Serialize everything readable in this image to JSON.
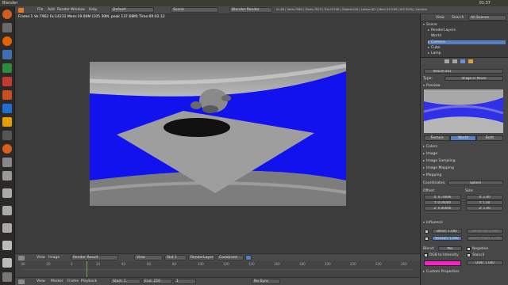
{
  "app": {
    "title": "Blender",
    "clock": "01:37"
  },
  "menubar": {
    "items": [
      "File",
      "Add",
      "Render",
      "Window",
      "Help"
    ],
    "screen": "Default",
    "scene": "Scene",
    "engine": "Blender Render",
    "stats": "v2.80 | Verts:7962 | Faces:7873 | Tris:15746 | Objects:0/4 | Lamps:0/1 | Mem:19.01M (105.30M) | Camera"
  },
  "viewport": {
    "header": "Frame:1 Ve:7962 Fa:14231 Mem:19.00M (105.30M, peak 137.68M) Time:00:02.12"
  },
  "image_editor": {
    "items": [
      "View",
      "Image"
    ],
    "image": "Render Result",
    "view": "View",
    "slot": "Slot 1",
    "layer": "RenderLayer",
    "pass": "Combined"
  },
  "timeline_header": {
    "items": [
      "View",
      "Marker",
      "Frame",
      "Playback"
    ],
    "start": "Start: 1",
    "end": "End: 250",
    "current": "1",
    "sync": "No Sync"
  },
  "timeline": {
    "ticks": [
      "-40",
      "-20",
      "0",
      "20",
      "40",
      "60",
      "80",
      "100",
      "120",
      "140",
      "160",
      "180",
      "200",
      "220",
      "240",
      "260"
    ]
  },
  "outliner": {
    "view": "View",
    "search": "Search",
    "filter": "All Scenes",
    "items": [
      "Scene",
      "RenderLayers",
      "World",
      "Camera",
      "Cube",
      "Lamp"
    ]
  },
  "properties": {
    "texture_name": "Texture.001",
    "type_label": "Type:",
    "type_value": "Image or Movie",
    "preview_label": "Preview",
    "preview_tabs": [
      "Texture",
      "World",
      "Both"
    ],
    "panels": [
      "Colors",
      "Image",
      "Image Sampling",
      "Image Mapping",
      "Mapping"
    ],
    "coordinates_label": "Coordinates:",
    "coordinates_value": "Sphere",
    "offset_label": "Offset:",
    "size_label": "Size:",
    "offset": [
      "X: 0.74696",
      "Y: 0.00000",
      "Z: 0.00000"
    ],
    "size": [
      "X: 1.00",
      "Y: 1.00",
      "Z: 1.00"
    ],
    "influence_label": "Influence",
    "blend_label": "Blend:",
    "blend_value": "Mix",
    "checks": [
      "Blend: 1.000",
      "Horizon: 1.000",
      "Zenith Up: 1.000",
      "Zenith Down: 1.000"
    ],
    "negative": "Negative",
    "rgb_to_intensity": "RGB to Intensity",
    "stencil": "Stencil",
    "dvar": "DVar: 1.000",
    "custom_properties": "Custom Properties",
    "color_swatch": "#ff1fc8"
  },
  "colors": {
    "sky": "#1212ee",
    "plane": "#9e9e9e",
    "accent": "#5680c2"
  }
}
